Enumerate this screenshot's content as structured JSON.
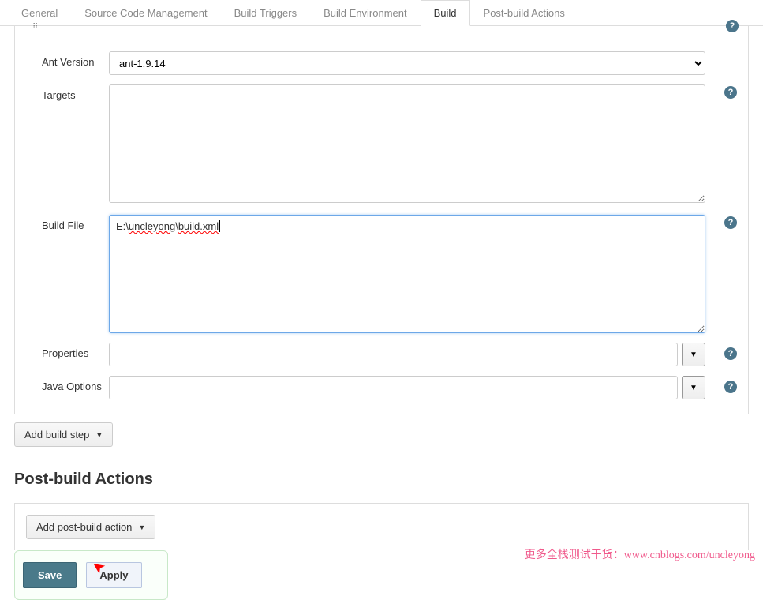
{
  "tabs": [
    {
      "label": "General"
    },
    {
      "label": "Source Code Management"
    },
    {
      "label": "Build Triggers"
    },
    {
      "label": "Build Environment"
    },
    {
      "label": "Build"
    },
    {
      "label": "Post-build Actions"
    }
  ],
  "active_tab_index": 4,
  "form": {
    "ant_version": {
      "label": "Ant Version",
      "value": "ant-1.9.14"
    },
    "targets": {
      "label": "Targets",
      "value": ""
    },
    "build_file": {
      "label": "Build File",
      "value": "E:\\uncleyong\\build.xml",
      "display_prefix": "E:\\",
      "display_spell1": "uncleyong",
      "display_mid": "\\",
      "display_spell2": "build.xml"
    },
    "properties": {
      "label": "Properties",
      "value": ""
    },
    "java_options": {
      "label": "Java Options",
      "value": ""
    }
  },
  "buttons": {
    "add_build_step": "Add build step",
    "add_post_build": "Add post-build action",
    "save": "Save",
    "apply": "Apply"
  },
  "headings": {
    "post_build": "Post-build Actions"
  },
  "watermark": "更多全栈测试干货：www.cnblogs.com/uncleyong"
}
